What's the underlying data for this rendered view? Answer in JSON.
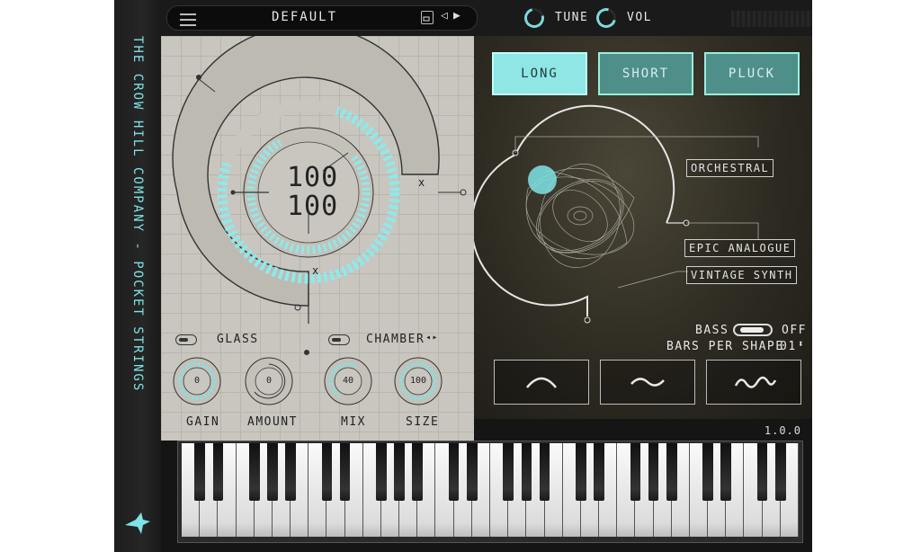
{
  "sidebar": {
    "title": "THE CROW HILL COMPANY  -  POCKET STRINGS"
  },
  "topbar": {
    "preset_name": "DEFAULT",
    "tune_label": "TUNE",
    "vol_label": "VOL",
    "icons": [
      "menu-icon",
      "save-icon",
      "prev-arrow-icon",
      "next-arrow-icon"
    ]
  },
  "main_dial": {
    "top_value": "100",
    "bottom_value": "100",
    "marker_a": "x",
    "marker_b": "x"
  },
  "toggles": {
    "glass_label": "GLASS",
    "chamber_label": "CHAMBER",
    "chamber_arrows": "◂▸"
  },
  "knobs": [
    {
      "label": "GAIN",
      "value": "0"
    },
    {
      "label": "AMOUNT",
      "value": "0"
    },
    {
      "label": "MIX",
      "value": "40"
    },
    {
      "label": "SIZE",
      "value": "100"
    }
  ],
  "modes": {
    "long": "LONG",
    "short": "SHORT",
    "pluck": "PLUCK",
    "active": "LONG"
  },
  "morph": {
    "labels": [
      "ORCHESTRAL",
      "EPIC ANALOGUE",
      "VINTAGE SYNTH"
    ]
  },
  "bass": {
    "label": "BASS",
    "state": "OFF"
  },
  "bars_per_shape": {
    "label": "BARS PER SHAPE",
    "value": "01"
  },
  "shapes": [
    "arc-shape-icon",
    "wave-shape-icon",
    "double-wave-shape-icon"
  ],
  "version": "1.0.0",
  "colors": {
    "accent": "#7fe3e6",
    "active_button": "#8fe6e4",
    "inactive_button": "#4f8f8a",
    "panel_paper": "#c9c6bf",
    "dark_panel": "#2e2b22"
  }
}
